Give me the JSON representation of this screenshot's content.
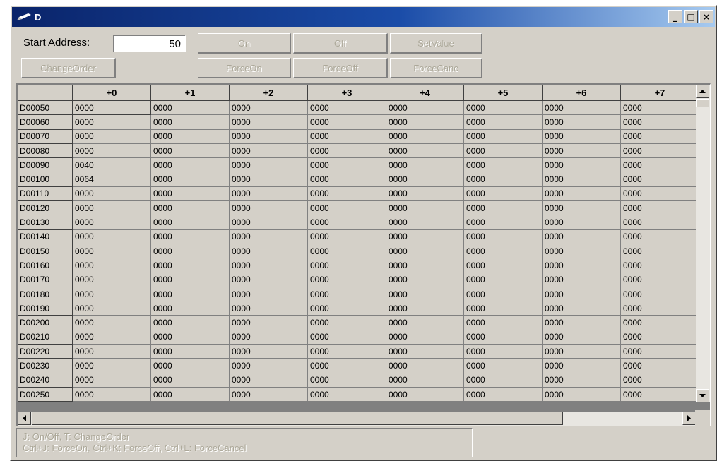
{
  "window": {
    "title": "D",
    "minimize_glyph": "_",
    "maximize_glyph": "□",
    "close_glyph": "×"
  },
  "toolbar": {
    "start_address_label": "Start Address:",
    "start_address_value": "50",
    "change_order": "ChangeOrder",
    "on": "On",
    "off": "Off",
    "set_value": "SetValue",
    "force_on": "ForceOn",
    "force_off": "ForceOff",
    "force_cancel": "ForceCanc"
  },
  "grid": {
    "columns": [
      "+0",
      "+1",
      "+2",
      "+3",
      "+4",
      "+5",
      "+6",
      "+7"
    ],
    "rows": [
      {
        "addr": "D00050",
        "values": [
          "0000",
          "0000",
          "0000",
          "0000",
          "0000",
          "0000",
          "0000",
          "0000"
        ]
      },
      {
        "addr": "D00060",
        "values": [
          "0000",
          "0000",
          "0000",
          "0000",
          "0000",
          "0000",
          "0000",
          "0000"
        ]
      },
      {
        "addr": "D00070",
        "values": [
          "0000",
          "0000",
          "0000",
          "0000",
          "0000",
          "0000",
          "0000",
          "0000"
        ]
      },
      {
        "addr": "D00080",
        "values": [
          "0000",
          "0000",
          "0000",
          "0000",
          "0000",
          "0000",
          "0000",
          "0000"
        ]
      },
      {
        "addr": "D00090",
        "values": [
          "0040",
          "0000",
          "0000",
          "0000",
          "0000",
          "0000",
          "0000",
          "0000"
        ]
      },
      {
        "addr": "D00100",
        "values": [
          "0064",
          "0000",
          "0000",
          "0000",
          "0000",
          "0000",
          "0000",
          "0000"
        ]
      },
      {
        "addr": "D00110",
        "values": [
          "0000",
          "0000",
          "0000",
          "0000",
          "0000",
          "0000",
          "0000",
          "0000"
        ]
      },
      {
        "addr": "D00120",
        "values": [
          "0000",
          "0000",
          "0000",
          "0000",
          "0000",
          "0000",
          "0000",
          "0000"
        ]
      },
      {
        "addr": "D00130",
        "values": [
          "0000",
          "0000",
          "0000",
          "0000",
          "0000",
          "0000",
          "0000",
          "0000"
        ]
      },
      {
        "addr": "D00140",
        "values": [
          "0000",
          "0000",
          "0000",
          "0000",
          "0000",
          "0000",
          "0000",
          "0000"
        ]
      },
      {
        "addr": "D00150",
        "values": [
          "0000",
          "0000",
          "0000",
          "0000",
          "0000",
          "0000",
          "0000",
          "0000"
        ]
      },
      {
        "addr": "D00160",
        "values": [
          "0000",
          "0000",
          "0000",
          "0000",
          "0000",
          "0000",
          "0000",
          "0000"
        ]
      },
      {
        "addr": "D00170",
        "values": [
          "0000",
          "0000",
          "0000",
          "0000",
          "0000",
          "0000",
          "0000",
          "0000"
        ]
      },
      {
        "addr": "D00180",
        "values": [
          "0000",
          "0000",
          "0000",
          "0000",
          "0000",
          "0000",
          "0000",
          "0000"
        ]
      },
      {
        "addr": "D00190",
        "values": [
          "0000",
          "0000",
          "0000",
          "0000",
          "0000",
          "0000",
          "0000",
          "0000"
        ]
      },
      {
        "addr": "D00200",
        "values": [
          "0000",
          "0000",
          "0000",
          "0000",
          "0000",
          "0000",
          "0000",
          "0000"
        ]
      },
      {
        "addr": "D00210",
        "values": [
          "0000",
          "0000",
          "0000",
          "0000",
          "0000",
          "0000",
          "0000",
          "0000"
        ]
      },
      {
        "addr": "D00220",
        "values": [
          "0000",
          "0000",
          "0000",
          "0000",
          "0000",
          "0000",
          "0000",
          "0000"
        ]
      },
      {
        "addr": "D00230",
        "values": [
          "0000",
          "0000",
          "0000",
          "0000",
          "0000",
          "0000",
          "0000",
          "0000"
        ]
      },
      {
        "addr": "D00240",
        "values": [
          "0000",
          "0000",
          "0000",
          "0000",
          "0000",
          "0000",
          "0000",
          "0000"
        ]
      },
      {
        "addr": "D00250",
        "values": [
          "0000",
          "0000",
          "0000",
          "0000",
          "0000",
          "0000",
          "0000",
          "0000"
        ]
      }
    ]
  },
  "status": {
    "line1": "J: On/Off,   T: ChangeOrder",
    "line2": "Ctrl+J: ForceOn,   Ctrl+K: ForceOff,   Ctrl+L: ForceCancel"
  },
  "icons": {
    "app": "pencil-icon",
    "scroll_up": "arrow-up-icon",
    "scroll_down": "arrow-down-icon",
    "scroll_left": "arrow-left-icon",
    "scroll_right": "arrow-right-icon"
  }
}
